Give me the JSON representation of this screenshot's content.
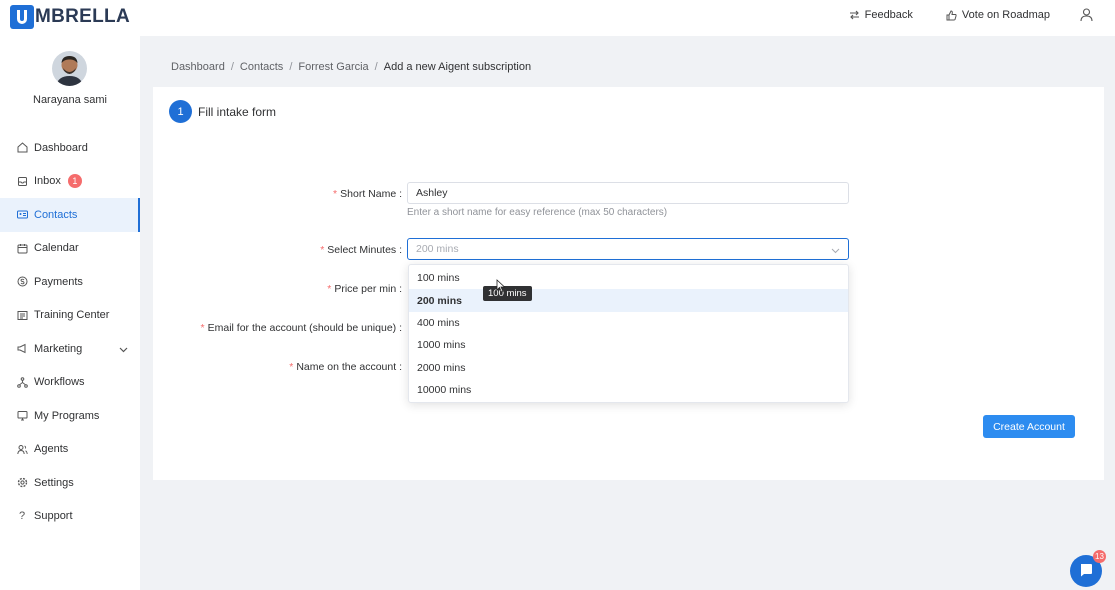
{
  "app": {
    "logo_text": "MBRELLA"
  },
  "topbar": {
    "feedback_label": "Feedback",
    "roadmap_label": "Vote on Roadmap"
  },
  "profile": {
    "name": "Narayana sami"
  },
  "sidebar": {
    "items": [
      {
        "label": "Dashboard",
        "icon": "home-icon"
      },
      {
        "label": "Inbox",
        "icon": "inbox-icon",
        "badge": "1"
      },
      {
        "label": "Contacts",
        "icon": "contacts-icon",
        "active": true
      },
      {
        "label": "Calendar",
        "icon": "calendar-icon"
      },
      {
        "label": "Payments",
        "icon": "payments-icon"
      },
      {
        "label": "Training Center",
        "icon": "training-icon"
      },
      {
        "label": "Marketing",
        "icon": "marketing-icon",
        "expandable": true
      },
      {
        "label": "Workflows",
        "icon": "workflows-icon"
      },
      {
        "label": "My Programs",
        "icon": "programs-icon"
      },
      {
        "label": "Agents",
        "icon": "agents-icon"
      },
      {
        "label": "Settings",
        "icon": "settings-icon"
      },
      {
        "label": "Support",
        "icon": "support-icon"
      }
    ]
  },
  "breadcrumb": {
    "items": [
      "Dashboard",
      "Contacts",
      "Forrest Garcia"
    ],
    "current": "Add a new Aigent subscription"
  },
  "step": {
    "number": "1",
    "title": "Fill intake form"
  },
  "form": {
    "short_name_label": "Short Name :",
    "short_name_value": "Ashley",
    "short_name_hint": "Enter a short name for easy reference (max 50 characters)",
    "minutes_label": "Select Minutes :",
    "minutes_placeholder": "200 mins",
    "price_label": "Price per min :",
    "email_label": "Email for the account (should be unique) :",
    "name_label": "Name on the account :",
    "required_mark": "*"
  },
  "dropdown": {
    "options": [
      "100 mins",
      "200 mins",
      "400 mins",
      "1000 mins",
      "2000 mins",
      "10000 mins"
    ],
    "selected_index": 1,
    "tooltip": "100 mins"
  },
  "create_button_label": "Create Account",
  "chat": {
    "badge": "13"
  },
  "colors": {
    "accent": "#1f6fd6",
    "button": "#2d8cf0",
    "badge": "#f56c6c"
  }
}
